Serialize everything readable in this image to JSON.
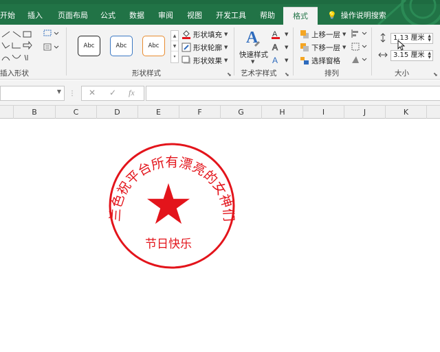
{
  "ribbon_tabs": [
    {
      "label": "开始"
    },
    {
      "label": "插入"
    },
    {
      "label": "页面布局"
    },
    {
      "label": "公式"
    },
    {
      "label": "数据"
    },
    {
      "label": "审阅"
    },
    {
      "label": "视图"
    },
    {
      "label": "开发工具"
    },
    {
      "label": "帮助"
    },
    {
      "label": "格式",
      "active": true
    }
  ],
  "tell_me": "操作说明搜索",
  "groups": {
    "insert_shapes": "插入形状",
    "shape_styles": "形状样式",
    "wordart_styles": "艺术字样式",
    "arrange": "排列",
    "size": "大小"
  },
  "style_gallery": [
    "Abc",
    "Abc",
    "Abc"
  ],
  "shape_cmds": {
    "fill": "形状填充",
    "outline": "形状轮廓",
    "effects": "形状效果"
  },
  "wordart": {
    "quick_styles": "快速样式"
  },
  "arrange_cmds": {
    "bring_forward": "上移一层",
    "send_backward": "下移一层",
    "selection_pane": "选择窗格"
  },
  "size": {
    "height": "1.13 厘米",
    "width": "3.15 厘米"
  },
  "formula_bar": {
    "cancel": "✕",
    "enter": "✓",
    "fx": "fx"
  },
  "columns": [
    "B",
    "C",
    "D",
    "E",
    "F",
    "G",
    "H",
    "I",
    "J",
    "K"
  ],
  "seal": {
    "arc_text": "兰色祝平台所有漂亮的女神们",
    "bottom_text": "节日快乐",
    "color": "#e3141b"
  },
  "colors": {
    "ribbon_green": "#217346",
    "seal_red": "#e3141b"
  }
}
